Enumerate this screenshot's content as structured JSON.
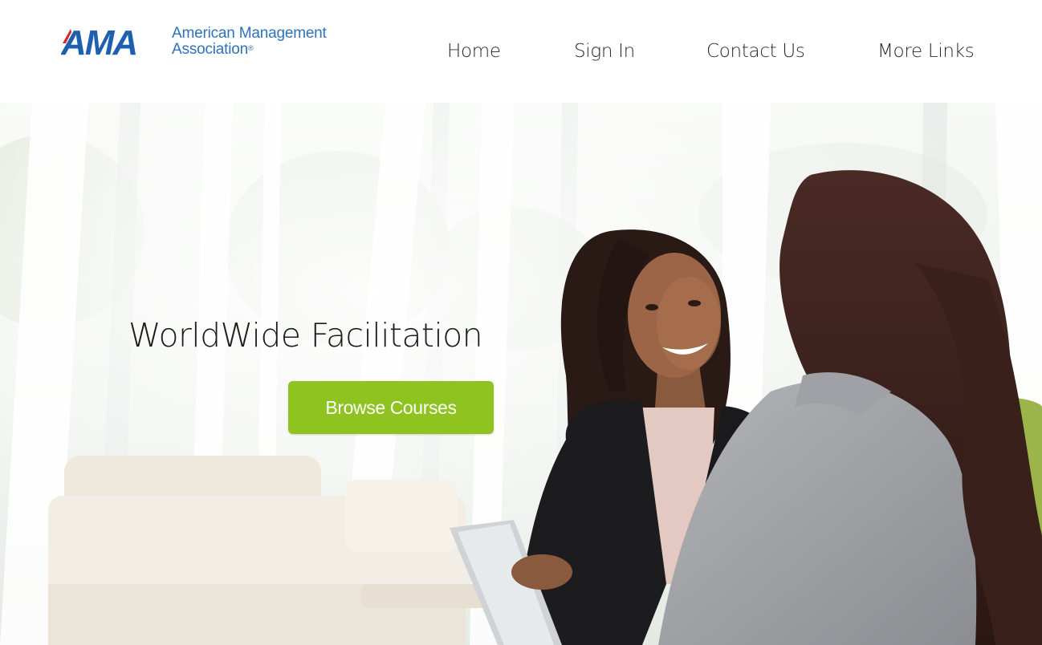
{
  "brand": {
    "logo_mark": "AMA",
    "name_line1": "American Management",
    "name_line2": "Association",
    "registered": "®",
    "colors": {
      "blue": "#1f5fb0",
      "red": "#d8262e",
      "text_blue": "#2f72b8"
    }
  },
  "nav": {
    "items": [
      {
        "label": "Home"
      },
      {
        "label": "Sign In"
      },
      {
        "label": "Contact Us"
      },
      {
        "label": "More Links"
      }
    ]
  },
  "hero": {
    "title": "WorldWide Facilitation",
    "cta_label": "Browse Courses",
    "cta_color": "#8fc31f",
    "image_subject": "two businesswomen in conversation with a tablet in a bright office lobby"
  }
}
